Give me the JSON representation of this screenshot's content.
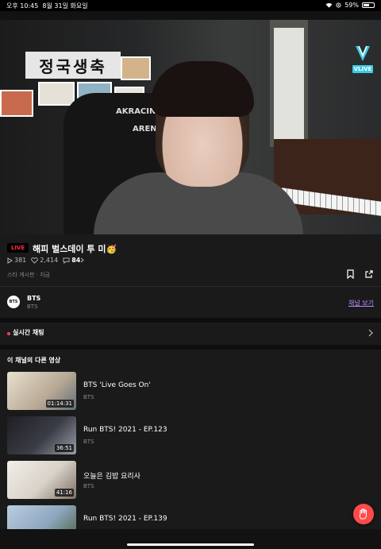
{
  "status_bar": {
    "time": "오후 10:45",
    "date": "8월 31일 화요일",
    "battery": "59%",
    "icons": [
      "wifi-icon",
      "location-icon",
      "battery-icon"
    ]
  },
  "video": {
    "wall_sign": "정국생축",
    "chair_brand_1": "AKRACING",
    "chair_brand_2": "ARENA",
    "logo_text": "VLIVE"
  },
  "info": {
    "live_badge": "LIVE",
    "title": "해피 벌스데이 투 미🥳",
    "views": "381",
    "likes": "2,414",
    "comments": "84",
    "meta": "스타 게시판 · 지금"
  },
  "channel": {
    "avatar_text": "BTS",
    "name": "BTS",
    "subtitle": "BTS",
    "link_label": "채널 보기"
  },
  "chat": {
    "label": "실시간 채팅"
  },
  "other_videos": {
    "heading": "이 채널의 다른 영상",
    "items": [
      {
        "title": "BTS 'Live Goes On'",
        "channel": "BTS",
        "duration": "01:14:31",
        "thumb_color": "#b8a894"
      },
      {
        "title": "Run BTS! 2021 - EP.123",
        "channel": "BTS",
        "duration": "36:51",
        "thumb_color": "#2e2e33"
      },
      {
        "title": "오늘은 김밥 요리사",
        "channel": "BTS",
        "duration": "41:16",
        "thumb_color": "#e8e4de"
      },
      {
        "title": "Run BTS! 2021 - EP.139",
        "channel": "",
        "duration": "",
        "thumb_color": "#9bb0c8"
      }
    ]
  },
  "colors": {
    "accent_purple": "#b98cff",
    "live_red": "#ff2a4a",
    "fab_red": "#ff4a4a",
    "vlive_cyan": "#3dc9e8"
  }
}
